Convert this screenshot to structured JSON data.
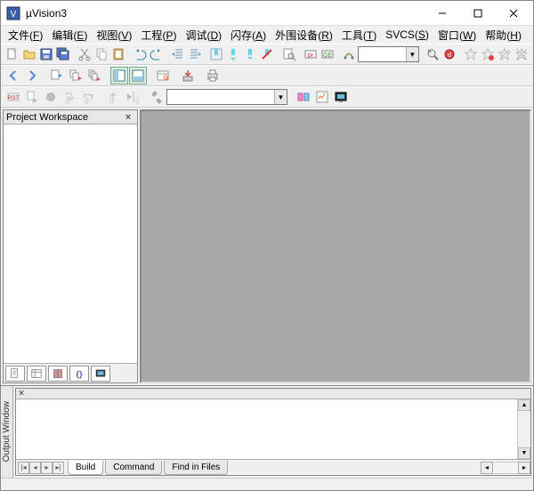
{
  "window": {
    "title": "µVision3"
  },
  "menu": {
    "file": {
      "label": "文件",
      "key": "F"
    },
    "edit": {
      "label": "编辑",
      "key": "E"
    },
    "view": {
      "label": "视图",
      "key": "V"
    },
    "project": {
      "label": "工程",
      "key": "P"
    },
    "debug": {
      "label": "调试",
      "key": "D"
    },
    "flash": {
      "label": "闪存",
      "key": "A"
    },
    "peripherals": {
      "label": "外围设备",
      "key": "R"
    },
    "tools": {
      "label": "工具",
      "key": "T"
    },
    "svcs": {
      "label": "SVCS",
      "key": "S"
    },
    "window": {
      "label": "窗口",
      "key": "W"
    },
    "help": {
      "label": "帮助",
      "key": "H"
    }
  },
  "workspace": {
    "title": "Project Workspace"
  },
  "output": {
    "label": "Output Window",
    "tabs": {
      "build": "Build",
      "command": "Command",
      "find": "Find in Files"
    }
  },
  "combos": {
    "target": "",
    "search": "",
    "filter": ""
  }
}
